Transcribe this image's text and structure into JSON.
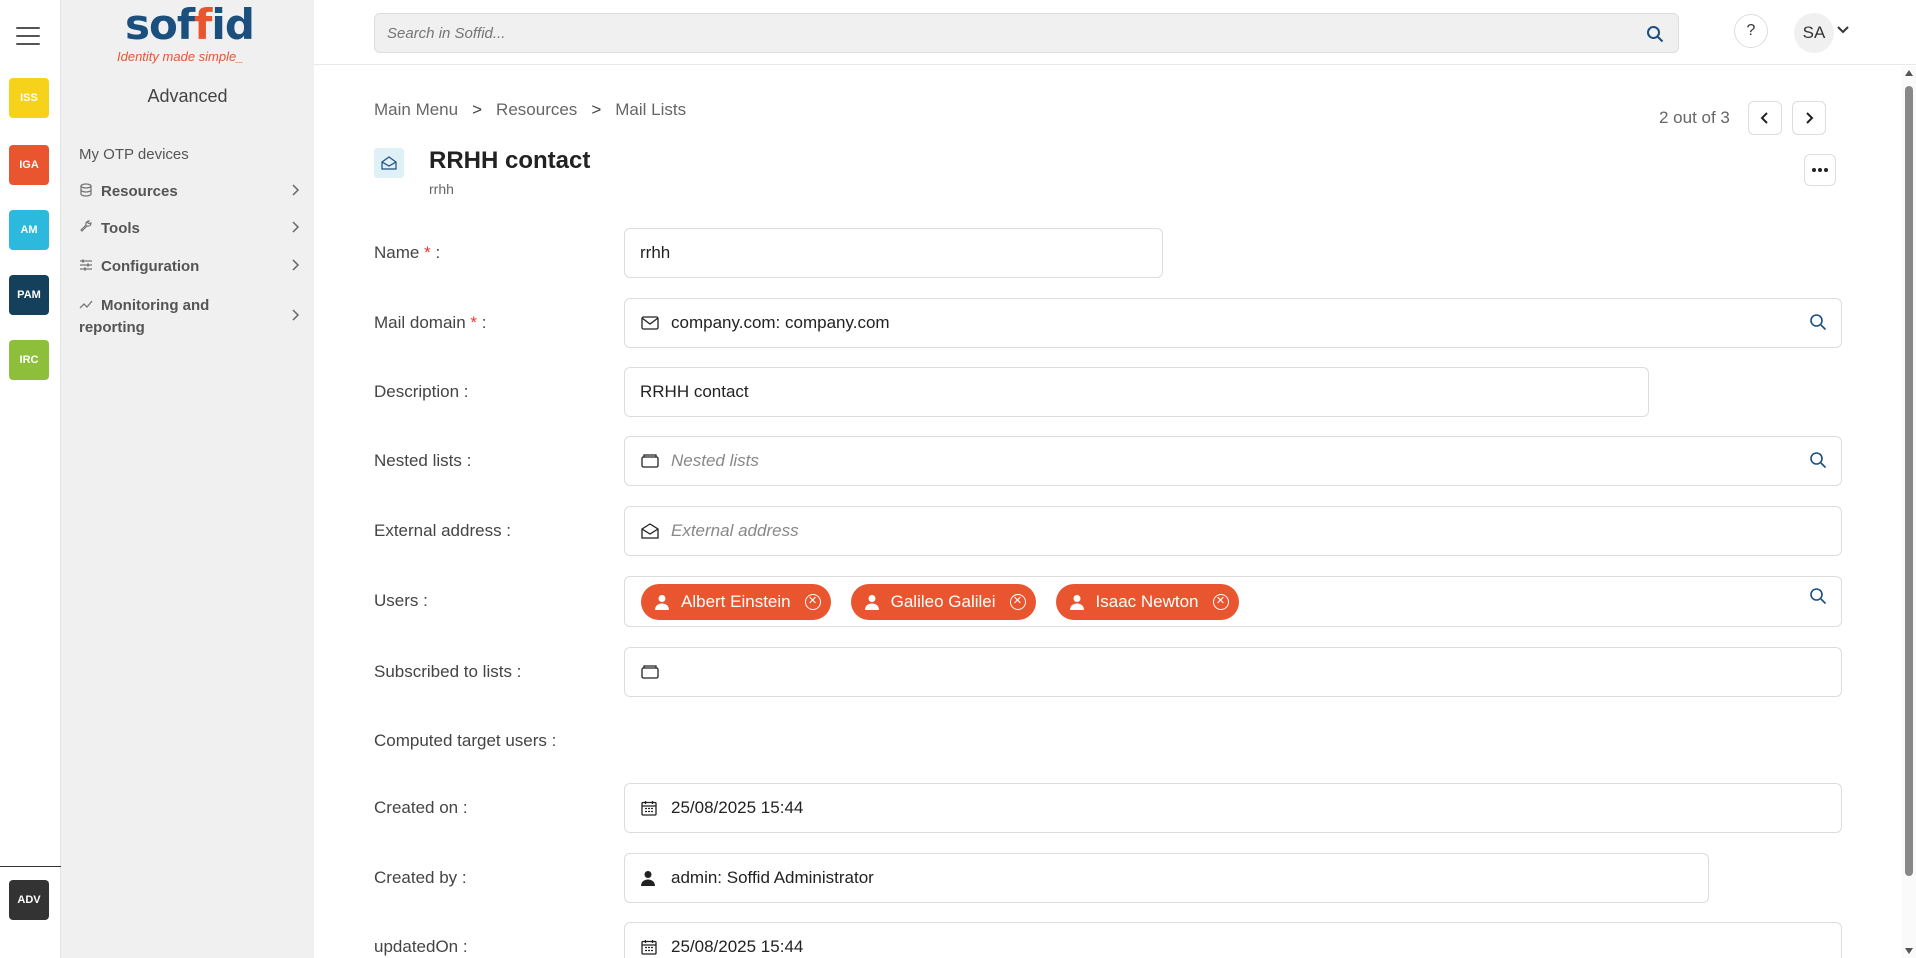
{
  "rail": {
    "items": [
      {
        "label": "ISS",
        "color": "#f7d21a"
      },
      {
        "label": "IGA",
        "color": "#e8552f"
      },
      {
        "label": "AM",
        "color": "#2cb9dd"
      },
      {
        "label": "PAM",
        "color": "#14405c"
      },
      {
        "label": "IRC",
        "color": "#8dbf3a"
      }
    ],
    "bottom": {
      "label": "ADV",
      "color": "#333333"
    }
  },
  "logo": {
    "word_a": "sof",
    "word_b": "f",
    "word_c": "id",
    "tagline": "Identity made simple_"
  },
  "sidebar": {
    "title": "Advanced",
    "items": [
      {
        "label": "My OTP devices",
        "icon": "none"
      },
      {
        "label": "Resources",
        "icon": "database-icon"
      },
      {
        "label": "Tools",
        "icon": "wrench-icon"
      },
      {
        "label": "Configuration",
        "icon": "sliders-icon"
      },
      {
        "label": "Monitoring and reporting",
        "icon": "trend-icon"
      }
    ]
  },
  "topbar": {
    "search_placeholder": "Search in Soffid...",
    "help": "?",
    "user_initials": "SA"
  },
  "breadcrumb": {
    "items": [
      "Main Menu",
      "Resources",
      "Mail Lists"
    ],
    "separator": ">"
  },
  "pager": {
    "text": "2 out of 3"
  },
  "header": {
    "title": "RRHH contact",
    "subtitle": "rrhh"
  },
  "form": {
    "name": {
      "label": "Name",
      "req": "*",
      "colon": ":",
      "value": "rrhh"
    },
    "mail_domain": {
      "label": "Mail domain",
      "req": "*",
      "colon": ":",
      "value": "company.com: company.com"
    },
    "description": {
      "label": "Description :",
      "value": "RRHH contact"
    },
    "nested_lists": {
      "label": "Nested lists :",
      "placeholder": "Nested lists"
    },
    "external_address": {
      "label": "External address :",
      "placeholder": "External address"
    },
    "users": {
      "label": "Users :",
      "chips": [
        "Albert Einstein",
        "Galileo Galilei",
        "Isaac Newton"
      ]
    },
    "subscribed": {
      "label": "Subscribed to lists :"
    },
    "computed": {
      "label": "Computed target users :"
    },
    "created_on": {
      "label": "Created on :",
      "value": "25/08/2025 15:44"
    },
    "created_by": {
      "label": "Created by :",
      "value": "admin: Soffid Administrator"
    },
    "updated_on": {
      "label": "updatedOn :",
      "value": "25/08/2025 15:44"
    }
  },
  "colors": {
    "accent": "#e8552f",
    "brand": "#1b4f7e",
    "icon_blue": "#1b4f7e"
  }
}
